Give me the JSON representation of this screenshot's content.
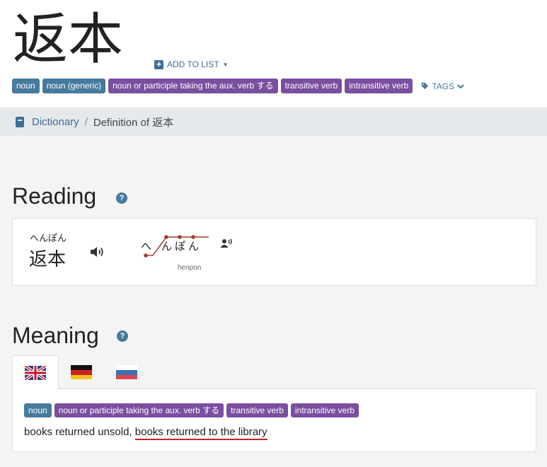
{
  "word": {
    "title": "返本",
    "add_to_list": "ADD TO LIST",
    "tags_label": "TAGS",
    "badges": [
      {
        "label": "noun",
        "color": "#457b9d"
      },
      {
        "label": "noun (generic)",
        "color": "#457b9d"
      },
      {
        "label": "noun or participle taking the aux. verb する",
        "color": "#7a4fa0"
      },
      {
        "label": "transitive verb",
        "color": "#7a4fa0"
      },
      {
        "label": "intransitive verb",
        "color": "#7a4fa0"
      }
    ]
  },
  "breadcrumb": {
    "icon": "book-icon",
    "link": "Dictionary",
    "separator": "/",
    "current": "Definition of 返本"
  },
  "reading": {
    "heading": "Reading",
    "furigana": "へんぽん",
    "kanji": "返本",
    "pitch_kana": [
      "へ",
      "ん",
      "ぽ",
      "ん"
    ],
    "pitch_pattern": "heiban",
    "romaji": "henpon",
    "audio_icon": "speaker-icon",
    "person_audio_icon": "person-voice-icon"
  },
  "meaning": {
    "heading": "Meaning",
    "languages": [
      {
        "name": "english",
        "icon": "uk-flag-icon",
        "active": true
      },
      {
        "name": "german",
        "icon": "germany-flag-icon",
        "active": false
      },
      {
        "name": "russian",
        "icon": "russia-flag-icon",
        "active": false
      }
    ],
    "badges": [
      {
        "label": "noun",
        "color": "#457b9d"
      },
      {
        "label": "noun or participle taking the aux. verb する",
        "color": "#7a4fa0"
      },
      {
        "label": "transitive verb",
        "color": "#7a4fa0"
      },
      {
        "label": "intransitive verb",
        "color": "#7a4fa0"
      }
    ],
    "gloss_plain": "books returned unsold,",
    "gloss_highlight": "books returned to the library"
  },
  "colors": {
    "accent": "#3d6e99",
    "badge_blue": "#457b9d",
    "badge_purple": "#7a4fa0",
    "pitch_line": "#a33b2e",
    "underline": "#c0262d"
  }
}
